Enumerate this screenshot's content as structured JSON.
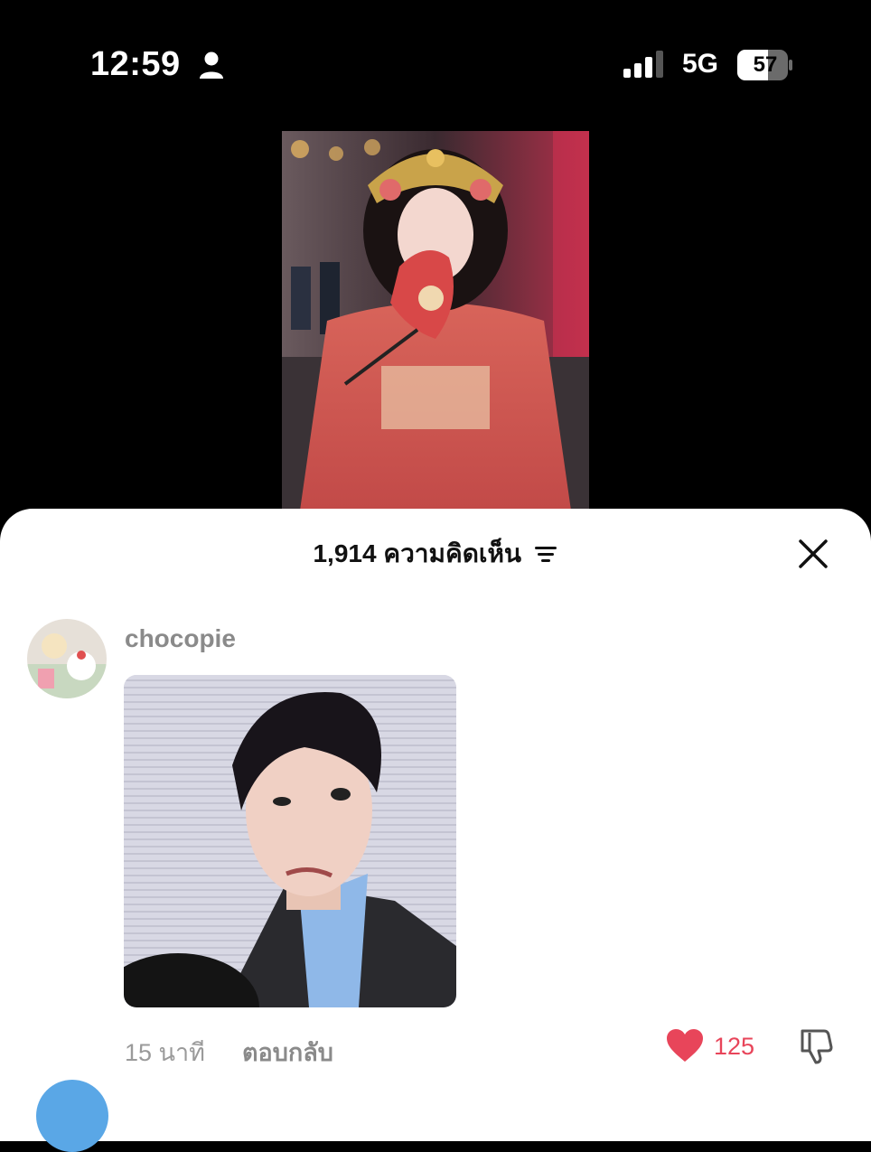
{
  "status_bar": {
    "time": "12:59",
    "network": "5G",
    "battery": "57",
    "icons": [
      "person-icon",
      "signal-icon"
    ]
  },
  "comments_sheet": {
    "title": "1,914 ความคิดเห็น",
    "icons": [
      "sort-icon",
      "close-icon"
    ],
    "comment": {
      "username": "chocopie",
      "time_ago": "15 นาที",
      "reply_label": "ตอบกลับ",
      "like_count": "125",
      "icons": [
        "heart-icon",
        "dislike-icon"
      ]
    }
  },
  "colors": {
    "like": "#e8455a",
    "text_muted": "#8a8a8a",
    "status_bar_bg": "#000000",
    "sheet_bg": "#ffffff"
  }
}
